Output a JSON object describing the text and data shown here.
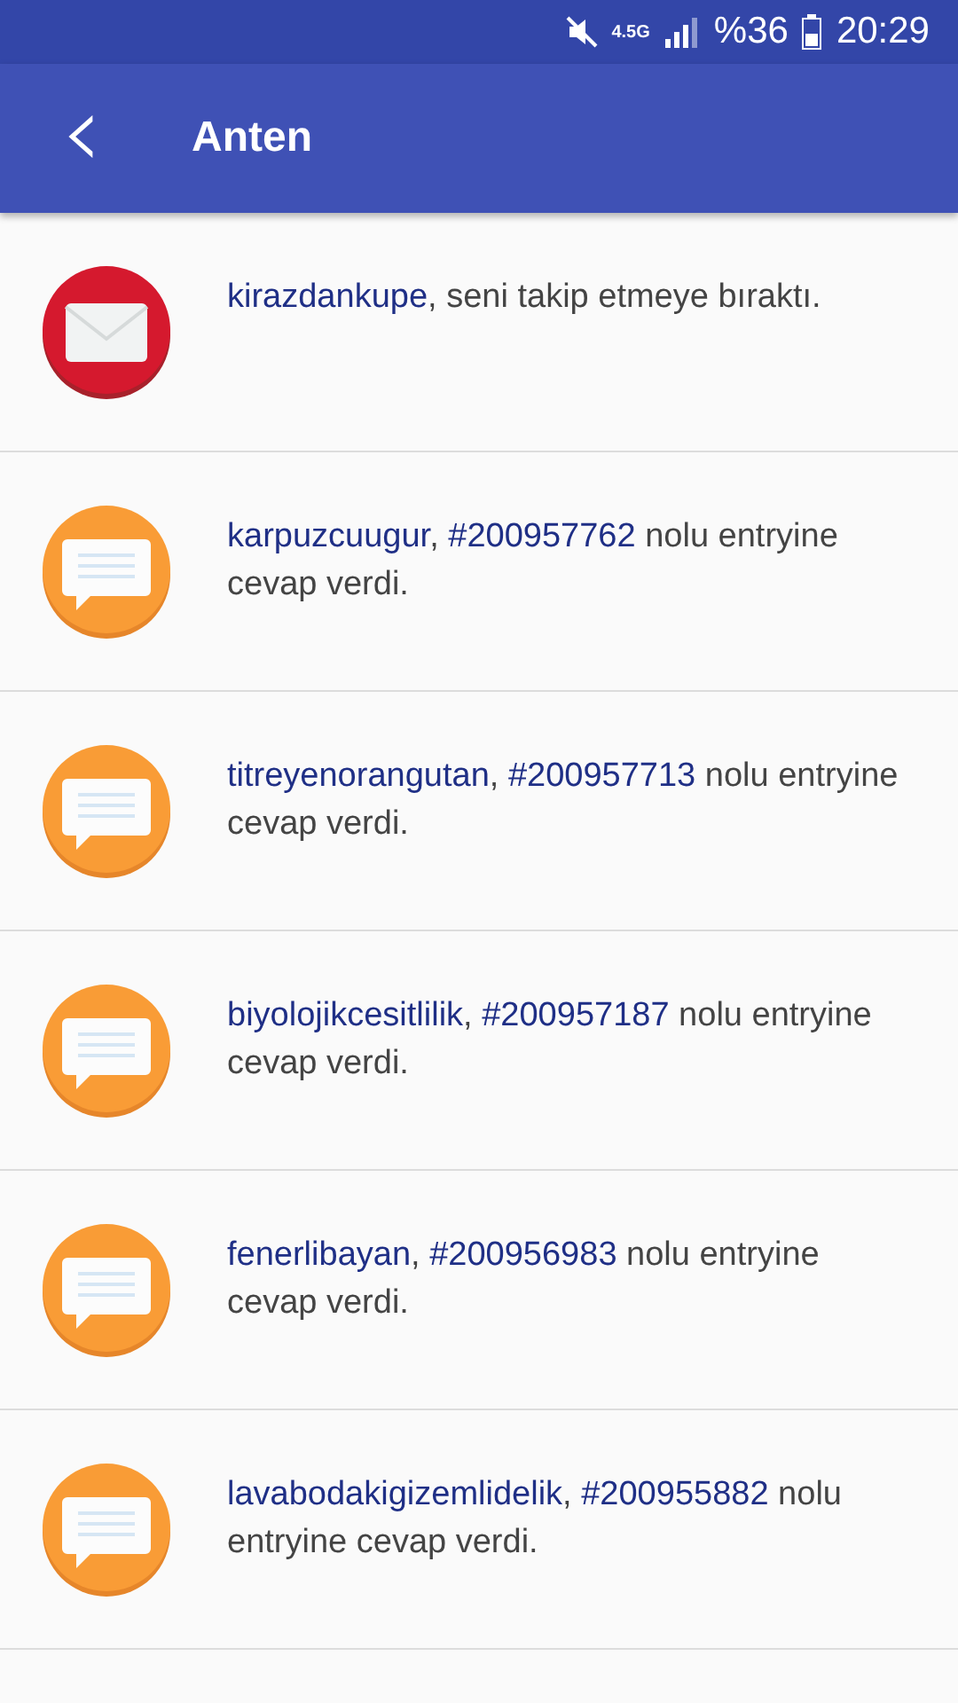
{
  "status_bar": {
    "network": "4.5G",
    "battery": "%36",
    "time": "20:29"
  },
  "app_bar": {
    "back": "‹",
    "title": "Anten"
  },
  "notifications": [
    {
      "kind": "unfollow",
      "parts": [
        {
          "text": "kirazdankupe",
          "link": true
        },
        {
          "text": ", seni takip etmeye bıraktı.",
          "link": false
        }
      ]
    },
    {
      "kind": "reply",
      "parts": [
        {
          "text": "karpuzcuugur",
          "link": true
        },
        {
          "text": ", ",
          "link": false
        },
        {
          "text": "#200957762",
          "link": true
        },
        {
          "text": " nolu entryine cevap verdi.",
          "link": false
        }
      ]
    },
    {
      "kind": "reply",
      "parts": [
        {
          "text": "titreyenorangutan",
          "link": true
        },
        {
          "text": ", ",
          "link": false
        },
        {
          "text": "#200957713",
          "link": true
        },
        {
          "text": " nolu entryine cevap verdi.",
          "link": false
        }
      ]
    },
    {
      "kind": "reply",
      "parts": [
        {
          "text": "biyolojikcesitlilik",
          "link": true
        },
        {
          "text": ", ",
          "link": false
        },
        {
          "text": "#200957187",
          "link": true
        },
        {
          "text": " nolu entryine cevap verdi.",
          "link": false
        }
      ]
    },
    {
      "kind": "reply",
      "parts": [
        {
          "text": "fenerlibayan",
          "link": true
        },
        {
          "text": ", ",
          "link": false
        },
        {
          "text": "#200956983",
          "link": true
        },
        {
          "text": " nolu entryine cevap verdi.",
          "link": false
        }
      ]
    },
    {
      "kind": "reply",
      "parts": [
        {
          "text": "lavabodakigizemlidelik",
          "link": true
        },
        {
          "text": ", ",
          "link": false
        },
        {
          "text": "#200955882",
          "link": true
        },
        {
          "text": " nolu entryine cevap verdi.",
          "link": false
        }
      ]
    }
  ]
}
